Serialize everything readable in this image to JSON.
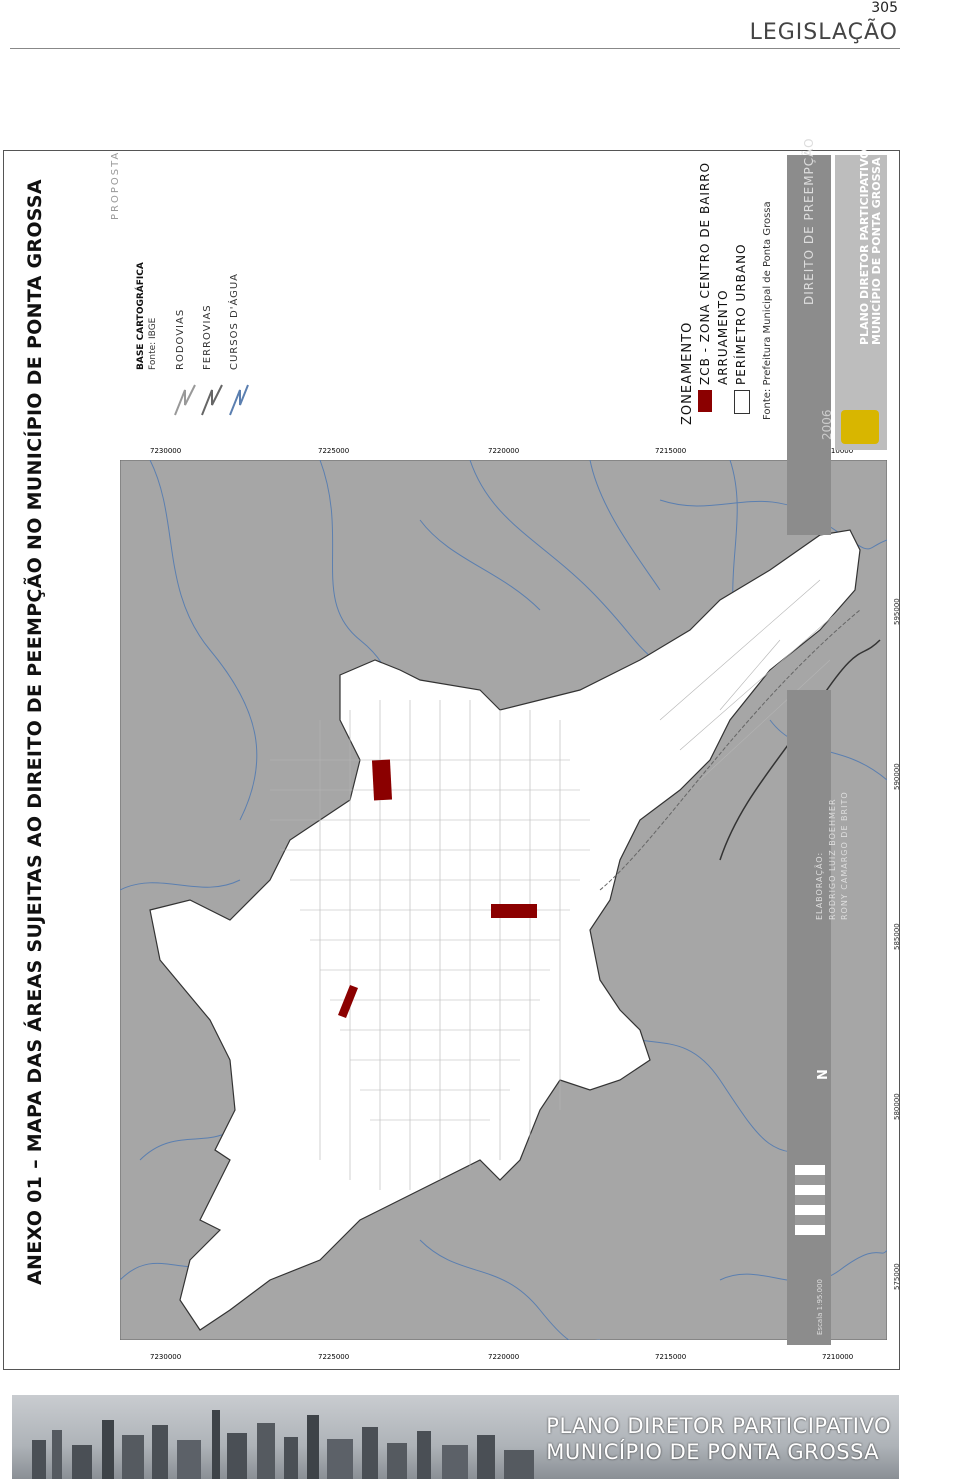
{
  "header": {
    "page_number": "305",
    "section": "LEGISLAÇÃO"
  },
  "map": {
    "title": "ANEXO 01 – MAPA DAS ÁREAS SUJEITAS AO DIREITO DE PEEMPÇÃO NO MUNICÍPIO DE PONTA GROSSA",
    "status": "PROPOSTA",
    "top_ticks": [
      "575000",
      "580000",
      "585000",
      "590000",
      "595000"
    ],
    "bottom_ticks": [
      "575000",
      "580000",
      "585000",
      "590000",
      "595000"
    ],
    "left_ticks": [
      "7230000",
      "7225000",
      "7220000",
      "7215000",
      "7210000"
    ],
    "right_ticks": [
      "7230000",
      "7225000",
      "7220000",
      "7215000",
      "7210000"
    ],
    "north_label": "N",
    "base_heading": "BASE CARTOGRÁFICA",
    "base_source": "Fonte: IBGE",
    "base_items": [
      "RODOVIAS",
      "FERROVIAS",
      "CURSOS D'ÁGUA"
    ],
    "zoning_heading": "ZONEAMENTO",
    "zoning_items": [
      {
        "label": "ZCB - ZONA CENTRO DE BAIRRO",
        "swatch": "#8b0000"
      },
      {
        "label": "ARRUAMENTO",
        "swatch": "none"
      },
      {
        "label": "PERÍMETRO URBANO",
        "swatch": "#ffffff"
      }
    ],
    "zoning_source": "Fonte: Prefeitura Municipal de Ponta Grossa",
    "panel_title": "DIREITO DE PREEMPÇÃO",
    "year": "2006",
    "plan_line1": "PLANO DIRETOR PARTICIPATIVO",
    "plan_line2": "MUNICÍPIO DE PONTA GROSSA",
    "elaboration": "ELABORAÇÃO:",
    "authors_line1": "RODRIGO LUIZ BOEHMER",
    "authors_line2": "RONY CAMARGO DE BRITO",
    "scale_label": "Escala 1:95.000",
    "colors": {
      "zone": "#8b0000",
      "water": "#5b7fb0",
      "background": "#a6a6a6",
      "urban": "#ffffff",
      "panel": "#8c8c8c"
    }
  },
  "footer": {
    "line1": "PLANO DIRETOR PARTICIPATIVO",
    "line2": "MUNICÍPIO DE PONTA GROSSA"
  }
}
